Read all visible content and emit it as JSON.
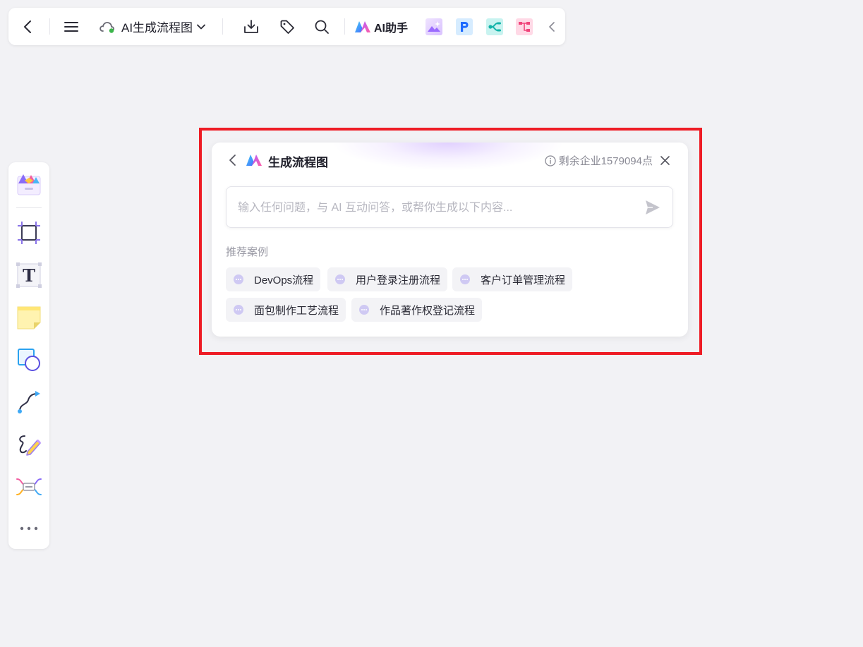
{
  "topbar": {
    "doc_title": "AI生成流程图",
    "ai_assistant_label": "AI助手",
    "icons": [
      "back-icon",
      "menu-icon",
      "cloud-sync-icon",
      "chevron-down-icon",
      "download-icon",
      "tag-icon",
      "search-icon",
      "ai-logo-icon",
      "image-gen-icon",
      "p-app-icon",
      "mindmap-app-icon",
      "flow-app-icon",
      "collapse-chevron-icon"
    ]
  },
  "sidebar": {
    "tools": [
      "template-icon",
      "frame-icon",
      "text-icon",
      "sticky-note-icon",
      "shape-icon",
      "connector-icon",
      "pen-icon",
      "mindmap-icon",
      "more-icon"
    ],
    "text_tool_glyph": "T"
  },
  "panel": {
    "title": "生成流程图",
    "quota": "剩余企业1579094点",
    "input_placeholder": "输入任何问题，与 AI 互动问答，或帮你生成以下内容...",
    "section_label": "推荐案例",
    "examples": [
      "DevOps流程",
      "用户登录注册流程",
      "客户订单管理流程",
      "面包制作工艺流程",
      "作品著作权登记流程"
    ]
  },
  "colors": {
    "highlight": "#ee1c25",
    "background": "#f2f2f5",
    "panel_bg": "#ffffff",
    "chip_bg": "#f3f3f6",
    "chip_icon": "#c9c4f0",
    "muted_text": "#8a8a95",
    "placeholder": "#b7b7c0"
  }
}
